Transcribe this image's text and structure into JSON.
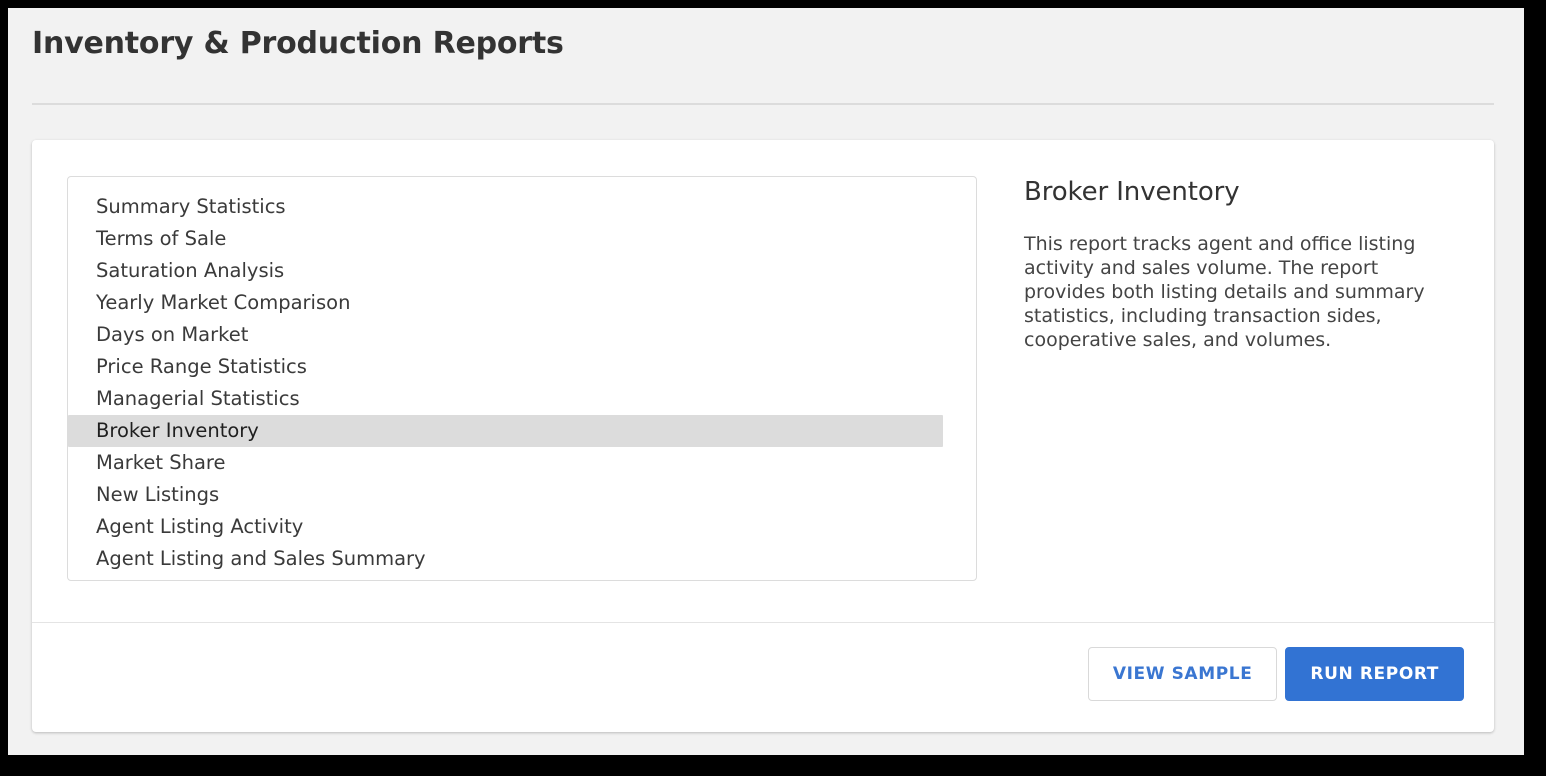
{
  "header": {
    "title": "Inventory & Production Reports"
  },
  "report_list": {
    "selected_index": 7,
    "items": [
      {
        "label": "Summary Statistics"
      },
      {
        "label": "Terms of Sale"
      },
      {
        "label": "Saturation Analysis"
      },
      {
        "label": "Yearly Market Comparison"
      },
      {
        "label": "Days on Market"
      },
      {
        "label": "Price Range Statistics"
      },
      {
        "label": "Managerial Statistics"
      },
      {
        "label": "Broker Inventory"
      },
      {
        "label": "Market Share"
      },
      {
        "label": "New Listings"
      },
      {
        "label": "Agent Listing Activity"
      },
      {
        "label": "Agent Listing and Sales Summary"
      }
    ]
  },
  "detail": {
    "title": "Broker Inventory",
    "description": "This report tracks agent and office listing activity and sales volume. The report provides both listing details and summary statistics, including transaction sides, cooperative sales, and volumes."
  },
  "footer": {
    "view_sample_label": "VIEW SAMPLE",
    "run_report_label": "RUN REPORT"
  },
  "colors": {
    "accent_blue": "#3273d3",
    "link_blue": "#3a76d1",
    "page_background": "#f2f2f2",
    "selected_row": "#dcdcdc",
    "title_text": "#333333"
  }
}
